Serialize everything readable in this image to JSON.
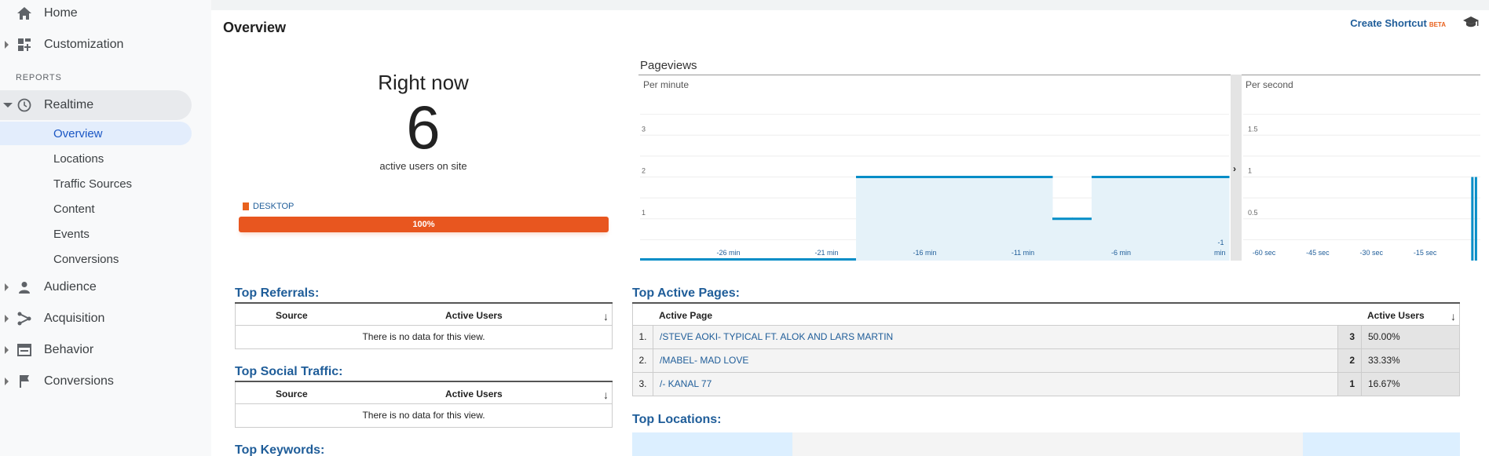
{
  "sidebar": {
    "home": "Home",
    "customization": "Customization",
    "reports_label": "REPORTS",
    "realtime": "Realtime",
    "realtime_items": [
      "Overview",
      "Locations",
      "Traffic Sources",
      "Content",
      "Events",
      "Conversions"
    ],
    "audience": "Audience",
    "acquisition": "Acquisition",
    "behavior": "Behavior",
    "conversions": "Conversions"
  },
  "header": {
    "title": "Overview",
    "create_shortcut": "Create Shortcut",
    "beta": "BETA"
  },
  "right_now": {
    "title": "Right now",
    "count": "6",
    "subtitle": "active users on site",
    "device_label": "DESKTOP",
    "device_percent": "100%",
    "device_fraction": 1.0
  },
  "pageviews": {
    "title": "Pageviews",
    "per_minute_label": "Per minute",
    "per_second_label": "Per second"
  },
  "chart_data": [
    {
      "type": "bar",
      "title": "Per minute",
      "ylim": [
        0,
        4
      ],
      "yticks": [
        "1",
        "2",
        "3"
      ],
      "xticks": [
        "-26 min",
        "-21 min",
        "-16 min",
        "-11 min",
        "-6 min",
        "-1 min"
      ],
      "x": [
        -30,
        -29,
        -28,
        -27,
        -26,
        -25,
        -24,
        -23,
        -22,
        -21,
        -20,
        -19,
        -18,
        -17,
        -16,
        -15,
        -14,
        -13,
        -12,
        -11,
        -10,
        -9,
        -8,
        -7,
        -6,
        -5,
        -4,
        -3,
        -2,
        -1
      ],
      "values": [
        0,
        0,
        0,
        0,
        0,
        0,
        0,
        0,
        0,
        0,
        0,
        2,
        2,
        2,
        2,
        2,
        2,
        2,
        2,
        2,
        2,
        1,
        1,
        2,
        2,
        2,
        2,
        2,
        2,
        2
      ],
      "color": "#058dc7"
    },
    {
      "type": "bar",
      "title": "Per second",
      "ylim": [
        0,
        2
      ],
      "yticks": [
        "0.5",
        "1",
        "1.5"
      ],
      "xticks": [
        "-60 sec",
        "-45 sec",
        "-30 sec",
        "-15 sec"
      ],
      "spikes": [
        {
          "x": -3,
          "value": 1
        },
        {
          "x": -2,
          "value": 1
        }
      ],
      "color": "#058dc7"
    }
  ],
  "top_referrals": {
    "title": "Top Referrals:",
    "col_source": "Source",
    "col_users": "Active Users",
    "empty": "There is no data for this view."
  },
  "top_social": {
    "title": "Top Social Traffic:",
    "col_source": "Source",
    "col_users": "Active Users",
    "empty": "There is no data for this view."
  },
  "top_keywords": {
    "title": "Top Keywords:"
  },
  "top_pages": {
    "title": "Top Active Pages:",
    "col_page": "Active Page",
    "col_users": "Active Users",
    "rows": [
      {
        "num": "1.",
        "page": "/STEVE AOKI- TYPICAL FT. ALOK AND LARS MARTIN",
        "count": "3",
        "pct": "50.00%"
      },
      {
        "num": "2.",
        "page": "/MABEL- MAD LOVE",
        "count": "2",
        "pct": "33.33%"
      },
      {
        "num": "3.",
        "page": "/- KANAL 77",
        "count": "1",
        "pct": "16.67%"
      }
    ]
  },
  "top_locations": {
    "title": "Top Locations:"
  }
}
